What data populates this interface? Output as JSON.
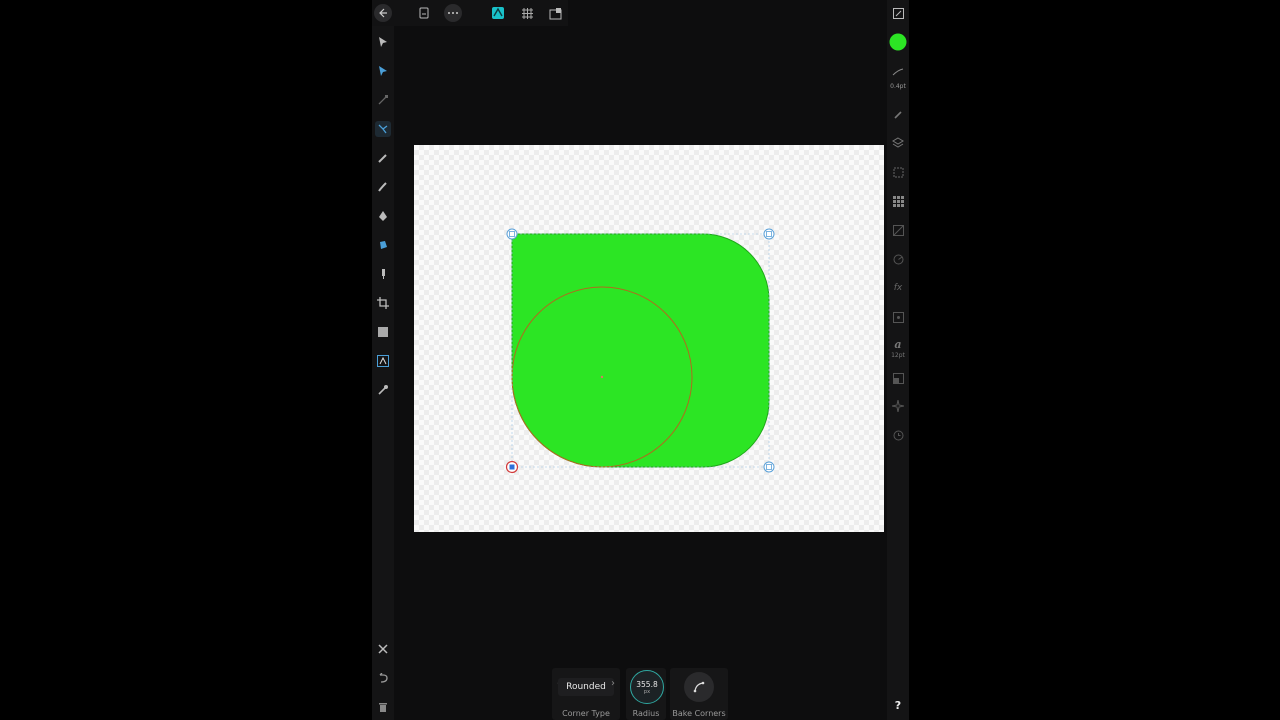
{
  "topbar": {
    "back": "back-arrow-icon",
    "document": "document-icon",
    "more": "more-icon",
    "persona_designer": "designer-persona-icon",
    "persona_pixel": "pixel-persona-icon",
    "persona_export": "export-persona-icon"
  },
  "left_tools": [
    "move-tool-icon",
    "node-tool-icon",
    "corner-tool-icon",
    "point-transform-icon",
    "pencil-tool-icon",
    "vector-brush-icon",
    "pen-tool-icon",
    "fill-tool-icon",
    "transparency-tool-icon",
    "crop-tool-icon",
    "shape-tool-icon",
    "text-tool-icon",
    "color-picker-icon"
  ],
  "right_panel": {
    "stroke_width": "0.4pt",
    "text_size": "12pt",
    "help": "?",
    "fill_color": "#2ce524"
  },
  "canvas": {
    "shape_fill": "#2ce524"
  },
  "context": {
    "corner_type_value": "Rounded",
    "corner_type_label": "Corner Type",
    "radius_value": "355.8",
    "radius_unit": "px",
    "radius_label": "Radius",
    "bake_label": "Bake Corners"
  },
  "colors": {
    "accent": "#2fa7a0",
    "selection": "#5aa0d8"
  }
}
